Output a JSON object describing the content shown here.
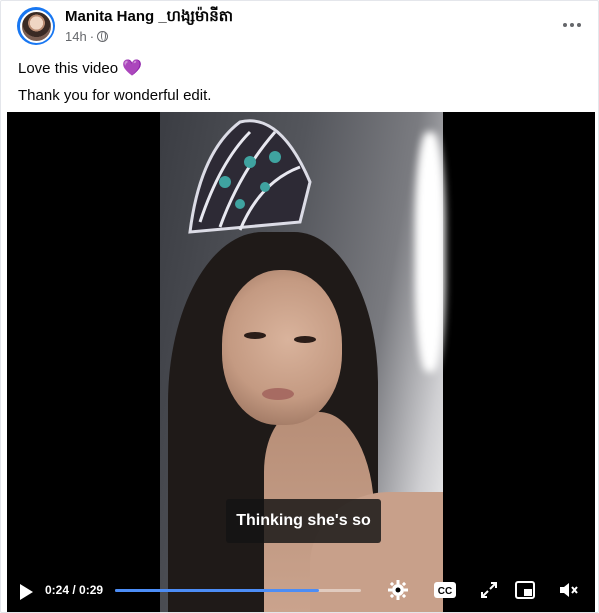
{
  "post": {
    "author_name": "Manita Hang _ហង្សម៉ានីតា",
    "timestamp": "14h",
    "separator": "·",
    "caption_line1": "Love this video",
    "caption_emoji": "💜",
    "caption_line2": "Thank you for wonderful edit."
  },
  "video": {
    "subtitle": "Thinking she's so",
    "current_time": "0:24",
    "duration": "0:29",
    "time_display": "0:24 / 0:29",
    "progress_fraction": 0.83,
    "cc_label": "CC"
  },
  "colors": {
    "progress": "#4c8df6",
    "avatar_ring": "#1877f2",
    "emoji": "#9b30d9"
  },
  "icons": [
    "globe-icon",
    "more-options-icon",
    "play-icon",
    "settings-gear-icon",
    "closed-captions-icon",
    "fullscreen-icon",
    "picture-in-picture-icon",
    "volume-icon"
  ]
}
